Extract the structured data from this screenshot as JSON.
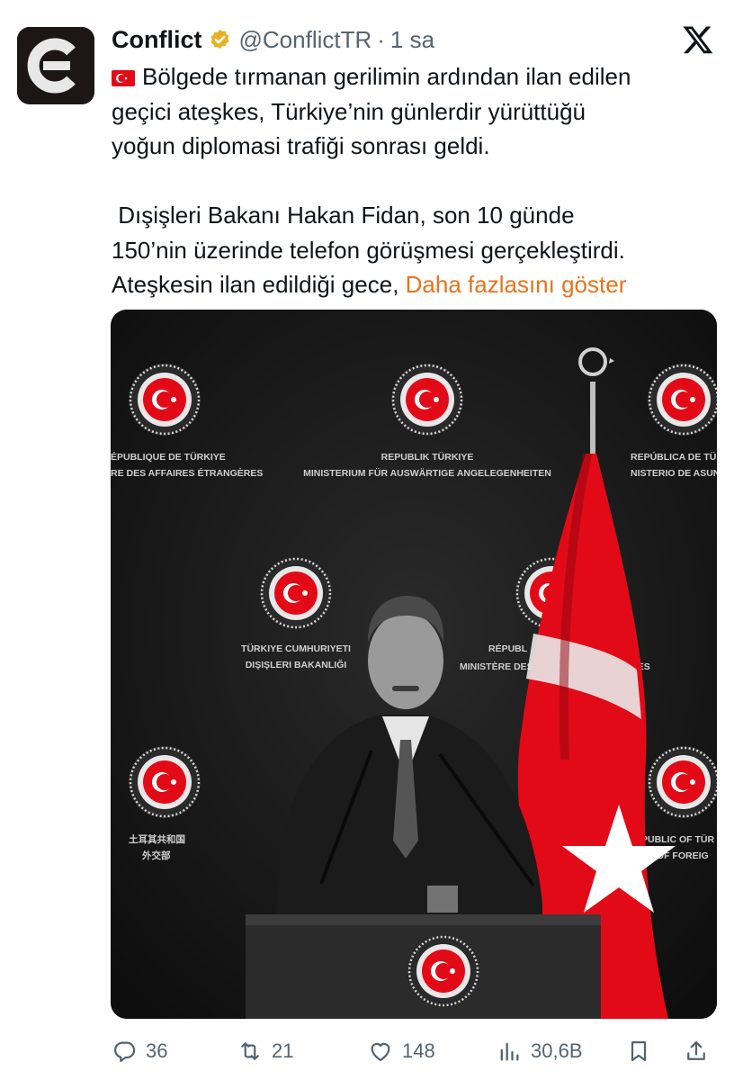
{
  "author": {
    "name": "Conflict",
    "handle": "@ConflictTR",
    "separator": "·",
    "time": "1 sa",
    "verified": true
  },
  "post": {
    "lines": [
      "Bölgede tırmanan gerilimin ardından ilan edilen",
      "geçici ateşkes, Türkiye’nin günlerdir yürüttüğü",
      "yoğun diplomasi trafiği sonrası geldi.",
      "Dışişleri Bakanı Hakan Fidan, son 10 günde",
      "150’nin üzerinde telefon görüşmesi gerçekleştirdi.",
      "Ateşkesin ilan edildiği gece,"
    ],
    "show_more": "Daha fazlasını göster"
  },
  "media": {
    "backdrop_texts": [
      "ÉPUBLIQUE DE TÜRKIYE",
      "RE DES AFFAIRES ÉTRANGÈRES",
      "REPUBLIK TÜRKIYE",
      "MINISTERIUM FÜR AUSWÄRTIGE ANGELEGENHEITEN",
      "REPÚBLICA DE TÜ",
      "NISTERIO DE ASUNTOS",
      "TÜRKIYE CUMHURIYETI",
      "DIŞIŞLERI BAKANLIĞI",
      "RÉPUBL",
      "MINISTÈRE DES",
      "GÈRES",
      "土耳其共和国",
      "外交部",
      "PUBLIC OF TÜR",
      "RY OF FOREIG"
    ]
  },
  "actions": {
    "replies": "36",
    "reposts": "21",
    "likes": "148",
    "views": "30,6B"
  },
  "colors": {
    "accent_link": "#e8731c",
    "verified_badge": "#e8b123",
    "flag_red": "#e30a17",
    "icon_gray": "#536471"
  }
}
